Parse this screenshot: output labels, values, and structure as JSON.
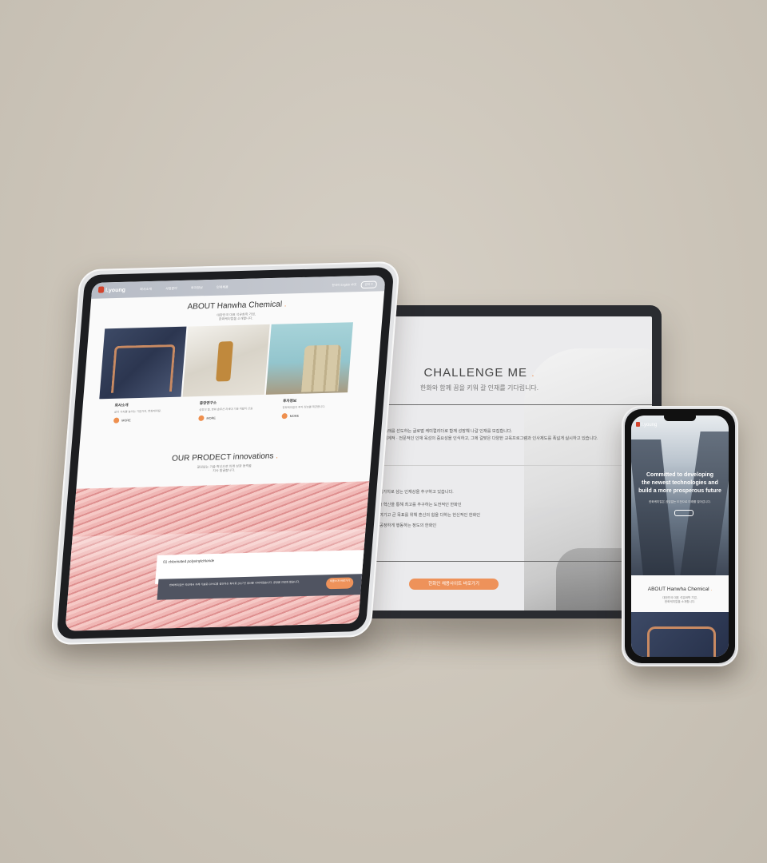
{
  "monitor": {
    "title": "CHALLENGE ME",
    "subtitle": "한화와 함께 꿈을 키워 갈 인재를 기다립니다.",
    "para1": "온 한화케미칼이 미래를 선도하는 글로벌 케미컬리더로 함께 성장해 나갈 인재를 모집합니다.",
    "para2": "본격화됨에 따라 체계적 · 전문적인 인재 육성의 중요성을 인식하고, 그에 걸맞은 다양한 교육프로그램과 인사제도를 폭넓게 실시하고 있습니다.",
    "values_intro": "신뢰'를 3대 핵심가치로 삼는 인재상을 추구하고 있습니다.",
    "value1": "변화와 혁신을 통해 최고를 추구하는 도전적인 한화인",
    "value2": "중히 여기고 큰 목표를 위해 혼신의 힘을 다하는 헌신적인 한화인",
    "value3": "지고 공정하게 행동하는 정도의 한화인",
    "button": "한화인 채용사이트 바로가기"
  },
  "tablet": {
    "logo": "l.young",
    "menu": [
      "회사소개",
      "사업분야",
      "투자정보",
      "인재채용"
    ],
    "util_text": "한국어 English 中文",
    "search_label": "검색",
    "about_title": "ABOUT Hanwha Chemical",
    "about_sub1": "대한민국 대표 석유화학 기업,",
    "about_sub2": "한화케미칼을 소개합니다.",
    "cards": [
      {
        "title": "회사소개",
        "desc": "삶의 가치를 높이는 기업가치, 한화케미칼.",
        "more": "MORE"
      },
      {
        "title": "중앙연구소",
        "desc": "성장의 힘, 한화 솔루션 차세대 기술 개발의 산실",
        "more": "MORE"
      },
      {
        "title": "투자정보",
        "desc": "한화케미칼의 투자 정보를 제공합니다.",
        "more": "MORE"
      }
    ],
    "product_title": "OUR PRODECT innovations",
    "product_sub1": "끊임없는 기술 혁신으로 미래 성장 동력을",
    "product_sub2": "지속 발굴합니다.",
    "product_label": "01   chlorinated polyvinylchloride",
    "product_desc": "한화케미칼은 국내에서 자체 기술로 CPVC를 생산하는 회사로 2017년 생산을 시작하였습니다. 공정을 안정화 했습니다.",
    "product_button": "제품소개 바로가기"
  },
  "phone": {
    "logo": "l.young",
    "hero_line1": "Committed to developing",
    "hero_line2": "the newest technologies and",
    "hero_line3": "build a more prosperous future",
    "hero_sub": "한화케미칼은 끊임없는 도전으로 미래를 열어갑니다.",
    "about_title": "ABOUT Hanwha Chemical",
    "about_sub1": "대한민국 대표 석유화학 기업,",
    "about_sub2": "한화케미칼을 소개합니다."
  },
  "colors": {
    "accent": "#ee925a",
    "background": "#cdc6bb",
    "dark": "#505461",
    "logo_red": "#d3442d"
  }
}
